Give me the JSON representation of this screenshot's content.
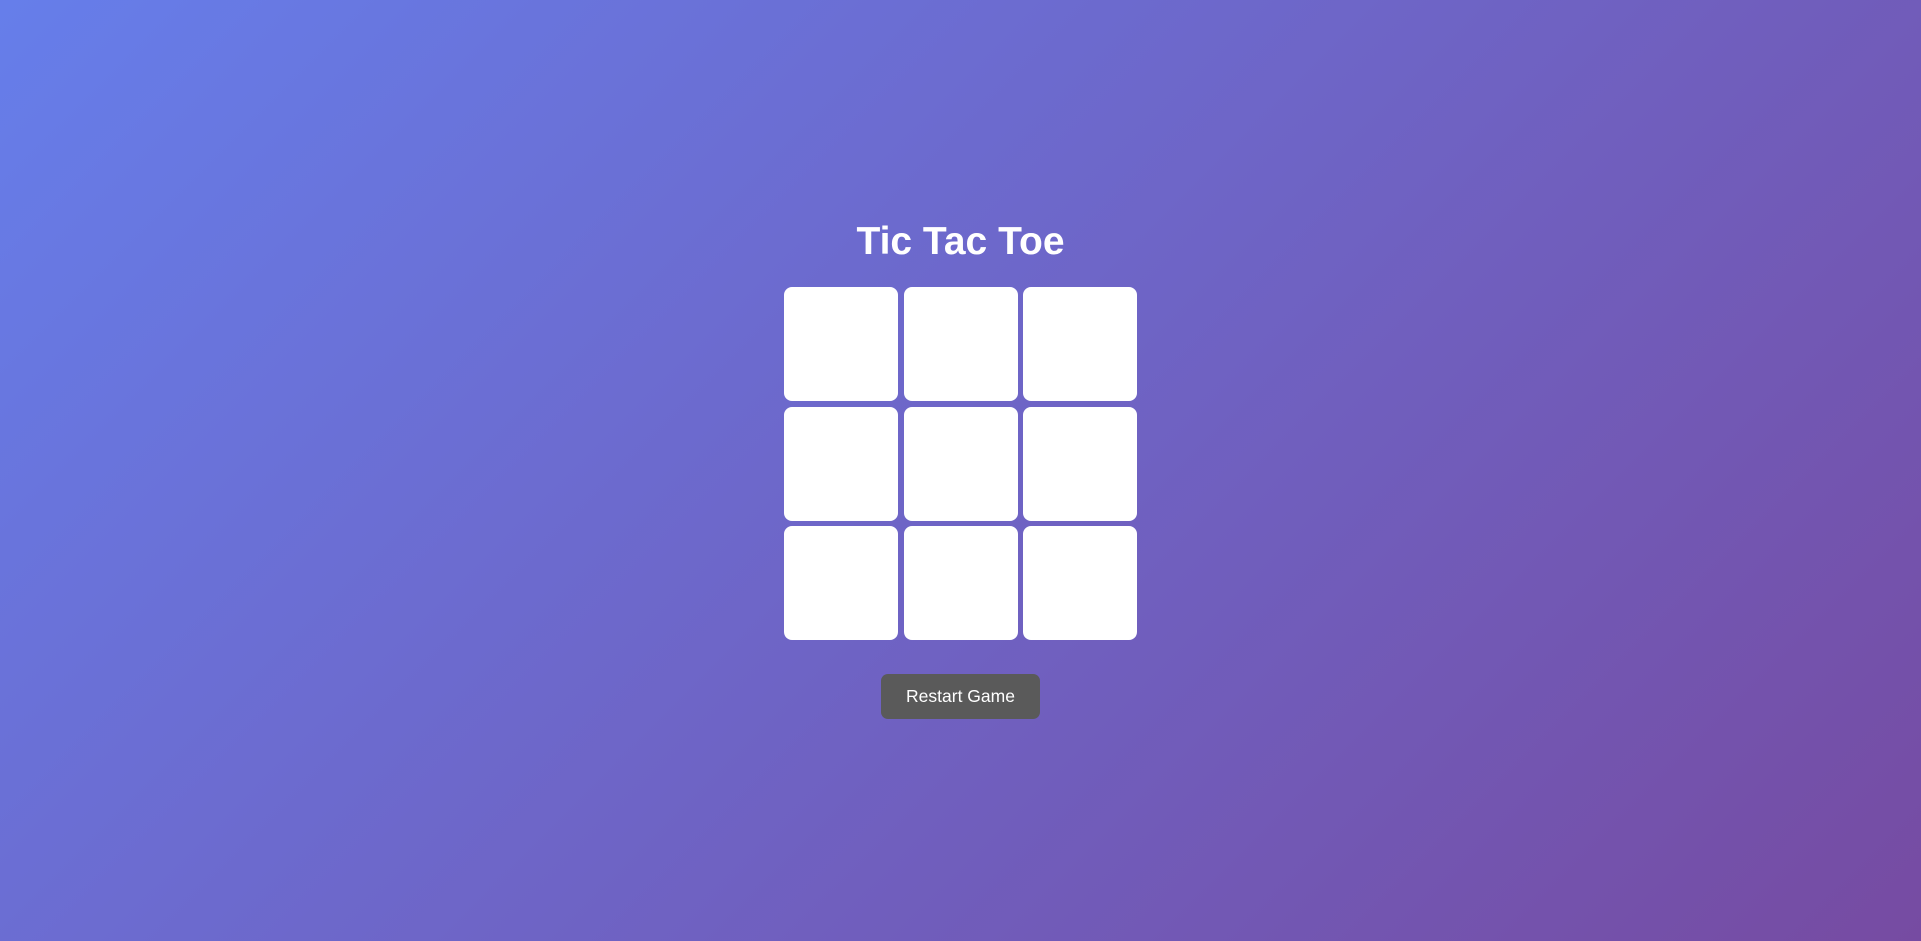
{
  "game": {
    "title": "Tic Tac Toe",
    "board": {
      "cells": [
        "",
        "",
        "",
        "",
        "",
        "",
        "",
        "",
        ""
      ]
    },
    "restart_label": "Restart Game"
  },
  "colors": {
    "background_start": "#667eea",
    "background_end": "#764ba2",
    "cell": "#ffffff",
    "button": "#5a5a5a",
    "title_text": "#ffffff"
  }
}
